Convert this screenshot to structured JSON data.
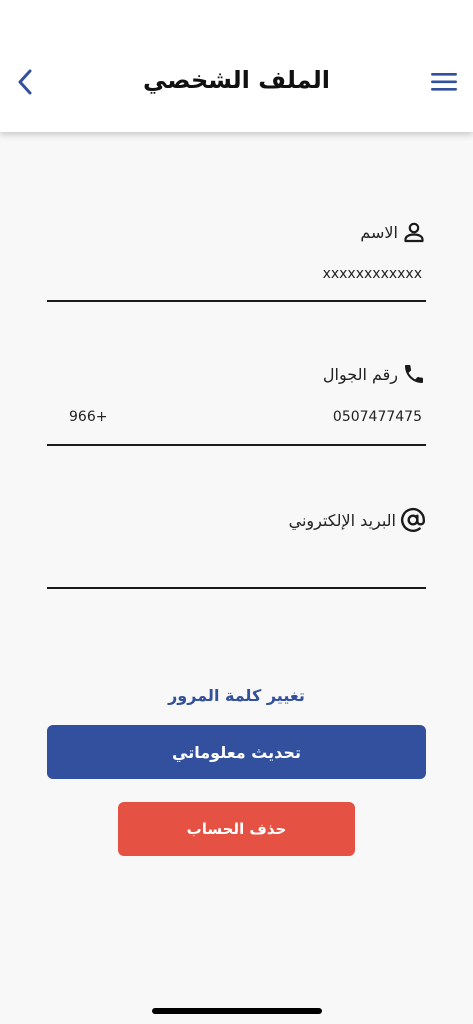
{
  "header": {
    "title": "الملف الشخصي"
  },
  "fields": {
    "name": {
      "label": "الاسم",
      "value": "xxxxxxxxxxxx"
    },
    "phone": {
      "label": "رقم الجوال",
      "country_code": "966+",
      "value": "0507477475"
    },
    "email": {
      "label": "البريد الإلكتروني",
      "value": ""
    }
  },
  "actions": {
    "change_password": "تغيير كلمة المرور",
    "update_info": "تحديث معلوماتي",
    "delete_account": "حذف الحساب"
  },
  "colors": {
    "primary": "#33509f",
    "danger": "#e55142",
    "background": "#f8f8f8"
  },
  "icons": {
    "back": "chevron-left-icon",
    "menu": "hamburger-menu-icon",
    "name": "user-icon",
    "phone": "phone-icon",
    "email": "at-sign-icon"
  }
}
